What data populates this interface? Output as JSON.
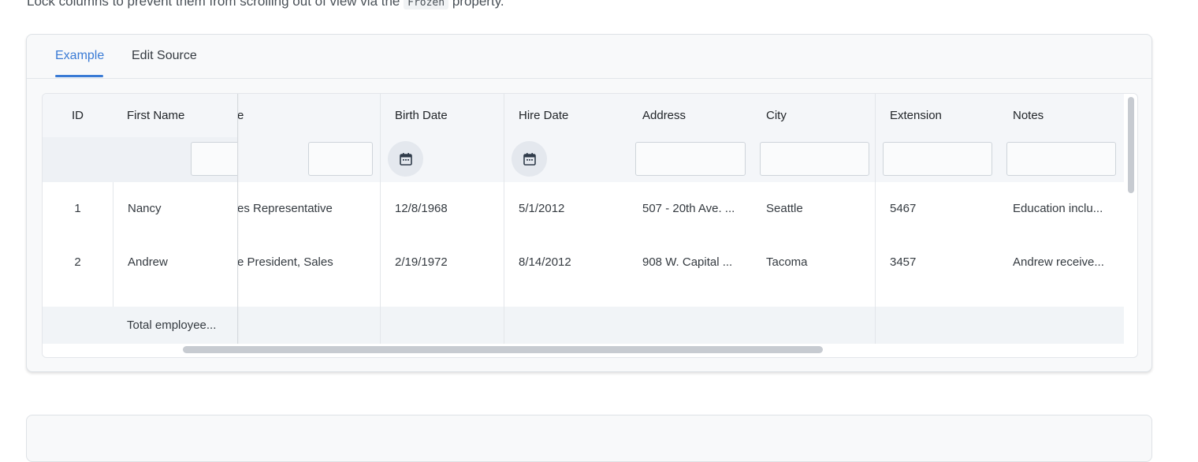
{
  "intro": {
    "before": "Lock columns to prevent them from scrolling out of view via the",
    "code": "Frozen",
    "after": "property."
  },
  "tabs": [
    {
      "label": "Example",
      "active": true
    },
    {
      "label": "Edit Source",
      "active": false
    }
  ],
  "accent": "#3a7bd5",
  "columns": {
    "id": "ID",
    "first_name": "First Name",
    "title_partial": "e",
    "birth_date": "Birth Date",
    "hire_date": "Hire Date",
    "address": "Address",
    "city": "City",
    "extension": "Extension",
    "notes": "Notes"
  },
  "rows": [
    {
      "id": "1",
      "first_name": "Nancy",
      "title": "es Representative",
      "birth_date": "12/8/1968",
      "hire_date": "5/1/2012",
      "address": "507 - 20th Ave. ...",
      "city": "Seattle",
      "extension": "5467",
      "notes": "Education inclu..."
    },
    {
      "id": "2",
      "first_name": "Andrew",
      "title": "e President, Sales",
      "birth_date": "2/19/1972",
      "hire_date": "8/14/2012",
      "address": "908 W. Capital ...",
      "city": "Tacoma",
      "extension": "3457",
      "notes": "Andrew receive..."
    }
  ],
  "footer": {
    "total_label": "Total employee..."
  },
  "icons": {
    "date_picker": "calendar-icon"
  }
}
